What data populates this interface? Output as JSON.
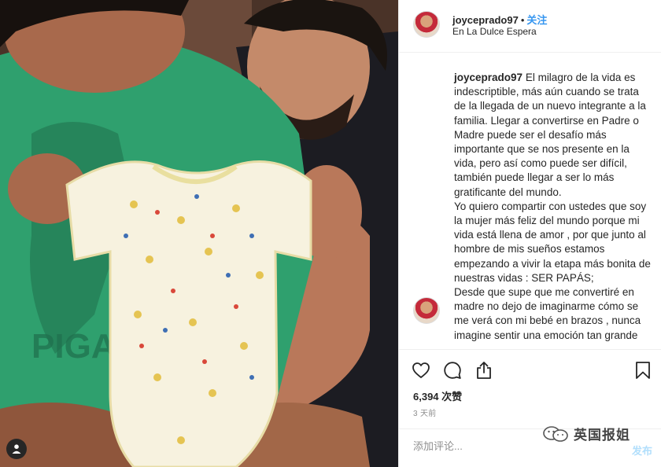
{
  "post": {
    "username": "joyceprado97",
    "separator": "•",
    "follow_label": "关注",
    "location": "En La Dulce Espera",
    "caption_user": "joyceprado97",
    "caption_part1": "El milagro de la vida es indescriptible, más aún cuando se trata de la llegada de un nuevo integrante a la familia. Llegar a convertirse en Padre o Madre puede ser el desafío más importante que se nos presente en la vida, pero así como puede ser difícil, también puede llegar a ser lo más gratificante del mundo.",
    "caption_part2": "Yo quiero compartir con ustedes que soy la mujer más feliz del mundo porque mi vida está llena de amor , por que junto al hombre de mis sueños estamos empezando a vivir la etapa más bonita de nuestras vidas : SER PAPÁS;",
    "caption_part3": "Desde que supe que me convertiré en madre no dejo de imaginarme cómo se me verá con mi bebé en brazos , nunca imagine sentir una emoción tan grande",
    "likes": "6,394 次赞",
    "time_ago": "3 天前",
    "comment_placeholder": "添加评论...",
    "post_label": "发布"
  },
  "icons": {
    "like": "heart-icon",
    "comment": "speech-bubble-icon",
    "share": "share-icon",
    "save": "bookmark-icon",
    "tag": "user-tag-icon"
  },
  "watermark": {
    "text": "英国报姐"
  },
  "colors": {
    "link_blue": "#3897f0",
    "post_disabled": "#b2dffc",
    "muted_gray": "#8e8e8e",
    "border": "#efefef",
    "shirt_green": "#2fa06e",
    "onesie_cream": "#f7f2df"
  }
}
